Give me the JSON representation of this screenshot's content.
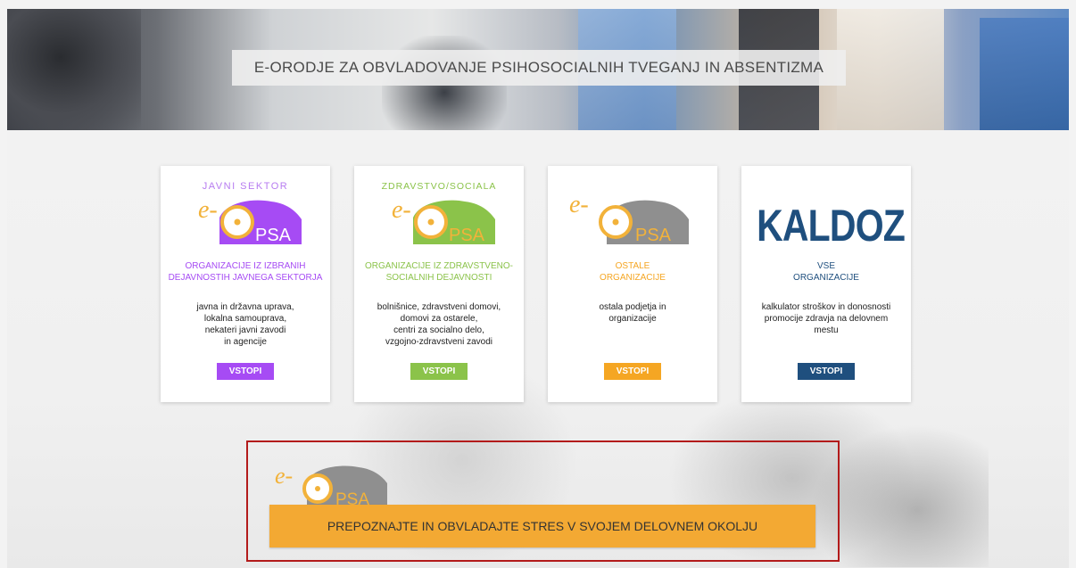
{
  "hero": {
    "title": "E-ORODJE ZA OBVLADOVANJE PSIHOSOCIALNIH TVEGANJ IN ABSENTIZMA"
  },
  "logo": {
    "prefix": "e-",
    "brand": "PSA"
  },
  "cards": [
    {
      "heading": "JAVNI SEKTOR",
      "org": "ORGANIZACIJE IZ IZBRANIH DEJAVNOSTIH JAVNEGA SEKTORJA",
      "desc_lines": [
        "javna in državna uprava,",
        "lokalna samouprava,",
        "nekateri javni zavodi",
        "in agencije"
      ],
      "button": "VSTOPI",
      "color": "#a64bf4"
    },
    {
      "heading": "ZDRAVSTVO/SOCIALA",
      "org": "ORGANIZACIJE IZ ZDRAVSTVENO-SOCIALNIH DEJAVNOSTI",
      "desc_lines": [
        "bolnišnice, zdravstveni domovi,",
        "domovi za ostarele,",
        "centri za socialno delo,",
        "vzgojno-zdravstveni zavodi"
      ],
      "button": "VSTOPI",
      "color": "#8bc34a"
    },
    {
      "heading": "",
      "org_lines": [
        "OSTALE",
        "ORGANIZACIJE"
      ],
      "desc_lines": [
        "ostala podjetja in",
        "organizacije"
      ],
      "button": "VSTOPI",
      "color": "#f5a623"
    },
    {
      "heading": "KALDOZ",
      "org_lines": [
        "VSE",
        "ORGANIZACIJE"
      ],
      "desc_lines": [
        "kalkulator stroškov in donosnosti",
        "promocije zdravja na delovnem",
        "mestu"
      ],
      "button": "VSTOPI",
      "color": "#1f4f7e"
    }
  ],
  "promo": {
    "button": "PREPOZNAJTE IN OBVLADAJTE STRES V SVOJEM DELOVNEM OKOLJU"
  }
}
